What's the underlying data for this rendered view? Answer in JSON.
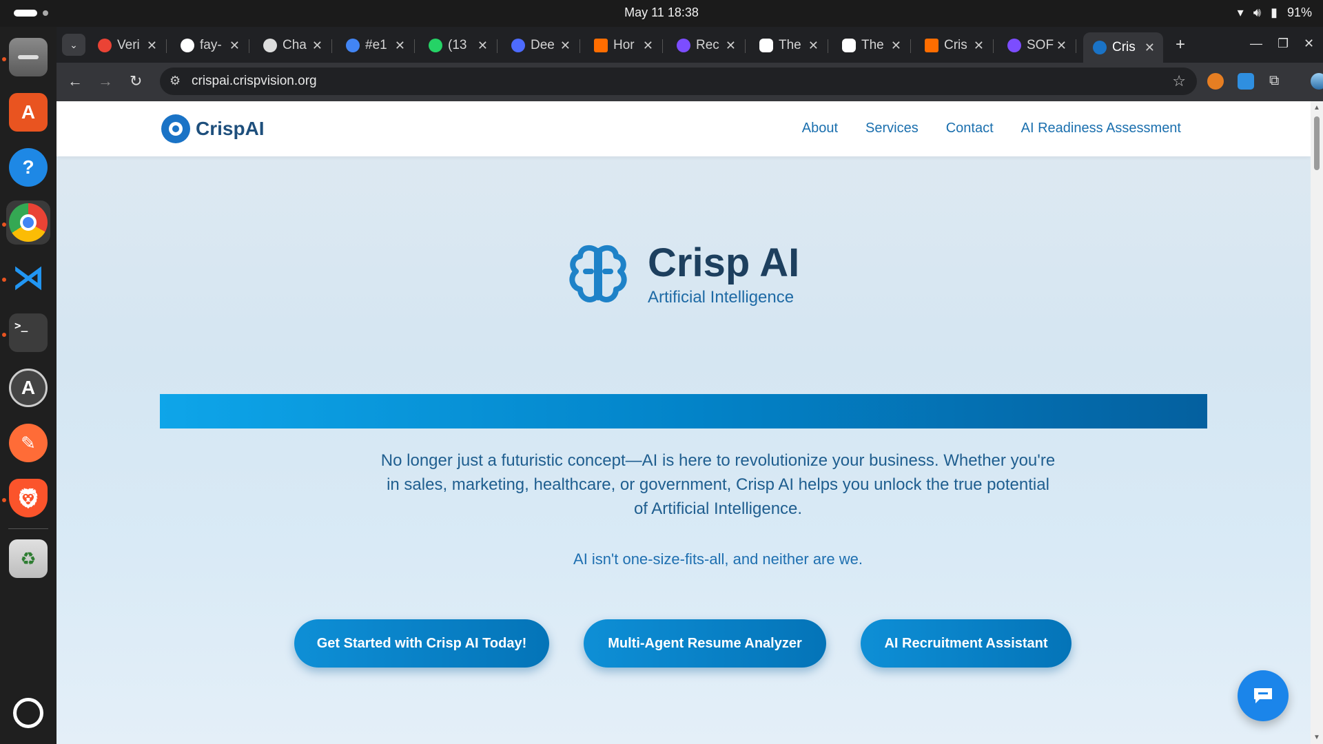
{
  "system": {
    "clock": "May 11  18:38",
    "battery": "91%"
  },
  "dock": {
    "apps": [
      "files-icon",
      "app-center-icon",
      "help-icon",
      "chrome-icon",
      "vscode-icon",
      "terminal-icon",
      "software-updater-icon",
      "postman-icon",
      "brave-icon",
      "trash-icon",
      "ubuntu-apps-icon"
    ]
  },
  "browser": {
    "tabs": [
      {
        "title": "Veri",
        "color": "#ea4335"
      },
      {
        "title": "fay-",
        "color": "#ffffff"
      },
      {
        "title": "Cha",
        "color": "#dddddd"
      },
      {
        "title": "#e1",
        "color": "#4285f4"
      },
      {
        "title": "(13",
        "color": "#25d366"
      },
      {
        "title": "Dee",
        "color": "#4d6bfe"
      },
      {
        "title": "Hor",
        "color": "#ff6d00"
      },
      {
        "title": "Rec",
        "color": "#7c4dff"
      },
      {
        "title": "The",
        "color": "#ffffff"
      },
      {
        "title": "The",
        "color": "#ffffff"
      },
      {
        "title": "Cris",
        "color": "#ff6d00"
      },
      {
        "title": "SOF",
        "color": "#7c4dff"
      },
      {
        "title": "Cris",
        "color": "#1a73c6"
      }
    ],
    "url": "crispai.crispvision.org"
  },
  "site": {
    "logo_text": "CrispAI",
    "nav": [
      "About",
      "Services",
      "Contact",
      "AI Readiness Assessment"
    ],
    "brand_title": "Crisp AI",
    "brand_subtitle": "Artificial Intelligence",
    "intro": "No longer just a futuristic concept—AI is here to revolutionize your business. Whether you're in sales, marketing, healthcare, or government, Crisp AI helps you unlock the true potential of Artificial Intelligence.",
    "tagline": "AI isn't one-size-fits-all, and neither are we.",
    "buttons": [
      "Get Started with Crisp AI Today!",
      "Multi-Agent Resume Analyzer",
      "AI Recruitment Assistant"
    ],
    "accent": "#0a85cf"
  }
}
